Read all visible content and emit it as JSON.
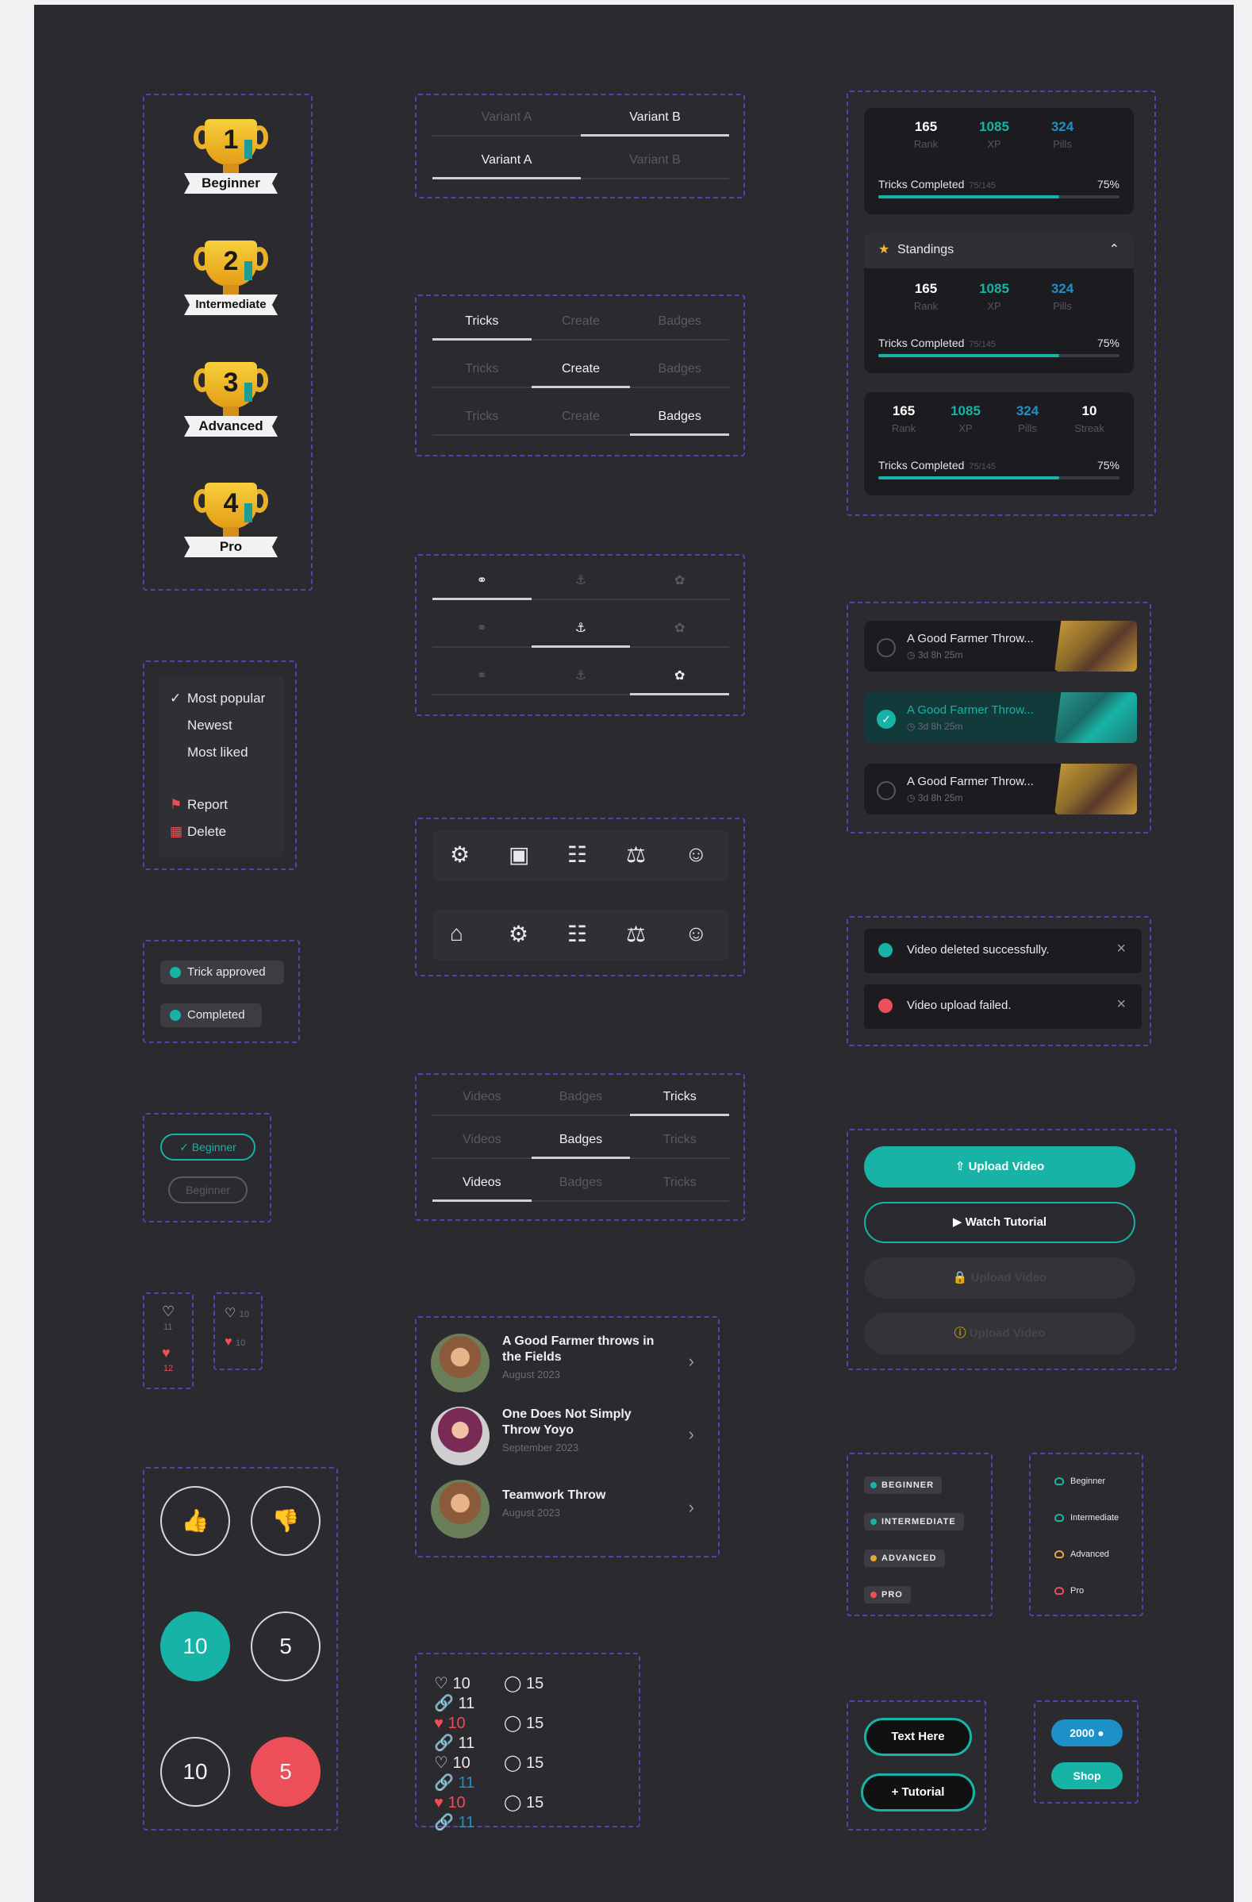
{
  "trophies": [
    {
      "num": "1",
      "label": "Beginner"
    },
    {
      "num": "2",
      "label": "Intermediate"
    },
    {
      "num": "3",
      "label": "Advanced"
    },
    {
      "num": "4",
      "label": "Pro"
    }
  ],
  "variant_tabs": [
    {
      "a": "Variant A",
      "b": "Variant B"
    },
    {
      "a": "Variant A",
      "b": "Variant B"
    }
  ],
  "text_tabs": [
    "Tricks",
    "Create",
    "Badges"
  ],
  "media_tabs": [
    "Videos",
    "Badges",
    "Tricks"
  ],
  "stats": {
    "rank": "165",
    "rank_label": "Rank",
    "xp": "1085",
    "xp_label": "XP",
    "pills": "324",
    "pills_label": "Pills",
    "streak": "10",
    "streak_label": "Streak",
    "progress_label": "Tricks Completed",
    "progress_sub": "75/145",
    "progress_pct": "75%",
    "progress_value": 0.75
  },
  "standings_title": "Standings",
  "sort_menu": {
    "items": [
      "Most popular",
      "Newest",
      "Most liked"
    ],
    "actions": [
      "Report",
      "Delete"
    ]
  },
  "status_badges": [
    "Trick approved",
    "Completed"
  ],
  "chips": [
    "Beginner",
    "Beginner"
  ],
  "mini_counts": {
    "a1": "11",
    "a2": "12",
    "b1": "10",
    "b2": "10"
  },
  "vote_buttons": {
    "c1": "10",
    "c2": "5",
    "c3": "10",
    "c4": "5"
  },
  "trick_list": [
    {
      "title": "A Good Farmer throws in the Fields",
      "date": "August 2023"
    },
    {
      "title": "One Does Not Simply Throw Yoyo",
      "date": "September 2023"
    },
    {
      "title": "Teamwork Throw",
      "date": "August 2023"
    }
  ],
  "engagement": {
    "likes": "10",
    "comments": "15",
    "shares": "11"
  },
  "feed_items": [
    {
      "title": "A Good Farmer Throw...",
      "time": "3d 8h 25m"
    },
    {
      "title": "A Good Farmer Throw...",
      "time": "3d 8h 25m"
    },
    {
      "title": "A Good Farmer Throw...",
      "time": "3d 8h 25m"
    }
  ],
  "toasts": [
    {
      "text": "Video deleted successfully.",
      "color": "#17b3a6"
    },
    {
      "text": "Video upload failed.",
      "color": "#ec4f57"
    }
  ],
  "action_buttons": {
    "upload": "Upload Video",
    "tutorial": "Watch Tutorial",
    "upload_locked": "Upload Video",
    "upload_pending": "Upload Video"
  },
  "levels_caps": [
    {
      "label": "BEGINNER",
      "color": "#17b3a6"
    },
    {
      "label": "INTERMEDIATE",
      "color": "#17b3a6"
    },
    {
      "label": "ADVANCED",
      "color": "#e7a53a"
    },
    {
      "label": "PRO",
      "color": "#ec4f57"
    }
  ],
  "levels_small": [
    {
      "label": "Beginner",
      "color": "#17b3a6"
    },
    {
      "label": "Intermediate",
      "color": "#17b3a6"
    },
    {
      "label": "Advanced",
      "color": "#e7a53a"
    },
    {
      "label": "Pro",
      "color": "#ec4f57"
    }
  ],
  "misc_buttons": {
    "text_here": "Text Here",
    "tutorial": "Tutorial",
    "coins": "2000",
    "shop": "Shop"
  },
  "colors": {
    "accent": "#17b3a6",
    "danger": "#ec4f57",
    "frame": "#5b3fb0"
  }
}
